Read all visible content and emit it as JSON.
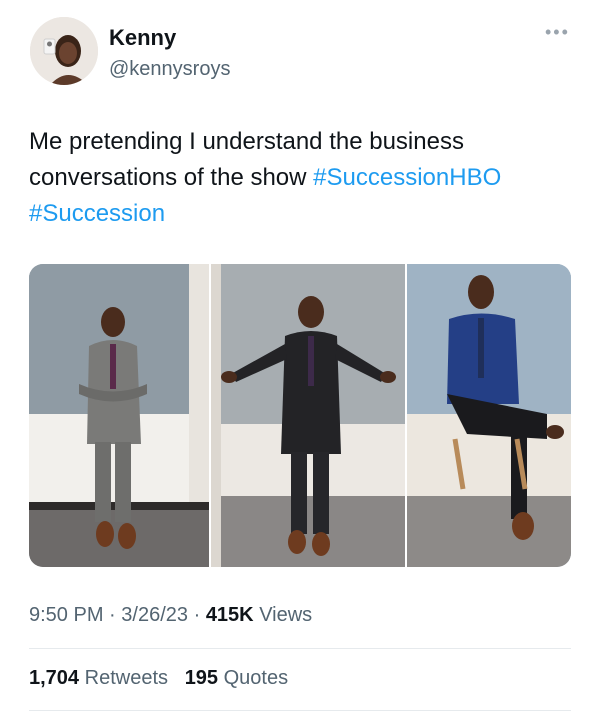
{
  "tweet": {
    "display_name": "Kenny",
    "handle": "@kennysroys",
    "more_icon": "more-horizontal-icon",
    "text_plain": "Me pretending I understand the business conversations of the show ",
    "hashtags": [
      "#SuccessionHBO",
      "#Succession"
    ],
    "photos": [
      {
        "description": "man in grey suit arms crossed"
      },
      {
        "description": "man in dark suit arms open"
      },
      {
        "description": "man in blue suit seated"
      }
    ],
    "time": "9:50 PM",
    "date": "3/26/23",
    "separator": "·",
    "views_count": "415K",
    "views_label": "Views",
    "retweets_count": "1,704",
    "retweets_label": "Retweets",
    "quotes_count": "195",
    "quotes_label": "Quotes"
  },
  "colors": {
    "accent": "#1d9bf0",
    "secondary_text": "#536471",
    "primary_text": "#0f1419"
  }
}
